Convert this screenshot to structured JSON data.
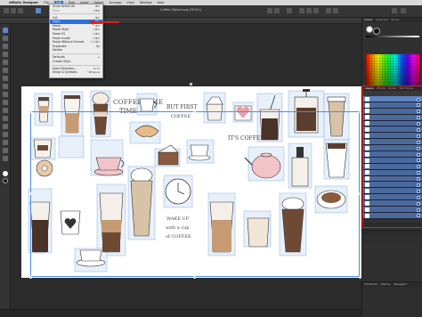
{
  "menubar": {
    "app_name": "Affinity Designer",
    "items": [
      {
        "label": "File"
      },
      {
        "label": "Edit",
        "active": true
      },
      {
        "label": "Text"
      },
      {
        "label": "Layer"
      },
      {
        "label": "Select"
      },
      {
        "label": "Arrange"
      },
      {
        "label": "View"
      },
      {
        "label": "Window"
      },
      {
        "label": "Help"
      }
    ]
  },
  "toolbar": {
    "document_title": "Coffee Object.svg (39.5%)"
  },
  "edit_menu": {
    "items": [
      {
        "label": "Undo Select All",
        "shortcut": "⌘Z",
        "state": "normal"
      },
      {
        "label": "Redo",
        "shortcut": "⇧⌘Z",
        "state": "disabled"
      },
      {
        "sep": true
      },
      {
        "label": "Cut",
        "shortcut": "⌘X",
        "state": "normal"
      },
      {
        "label": "Copy",
        "shortcut": "⌘C",
        "state": "highlighted"
      },
      {
        "label": "Paste",
        "shortcut": "⌘V",
        "state": "normal"
      },
      {
        "label": "Paste Style",
        "shortcut": "⇧⌘V",
        "state": "normal"
      },
      {
        "label": "Paste FX",
        "shortcut": "⌥⌘V",
        "state": "normal"
      },
      {
        "label": "Paste Inside",
        "shortcut": "⌥⌘V",
        "state": "normal"
      },
      {
        "label": "Paste Without Format",
        "shortcut": "⌥⇧⌘V",
        "state": "normal"
      },
      {
        "label": "Duplicate",
        "shortcut": "⌘J",
        "state": "normal"
      },
      {
        "label": "Delete",
        "shortcut": "",
        "state": "normal"
      },
      {
        "sep": true
      },
      {
        "label": "Defaults",
        "shortcut": "▸",
        "state": "normal"
      },
      {
        "label": "Create Style",
        "shortcut": "",
        "state": "normal"
      },
      {
        "sep": true
      },
      {
        "label": "Start Dictation...",
        "shortcut": "fn fn",
        "state": "normal"
      },
      {
        "label": "Emoji & Symbols",
        "shortcut": "^⌘Space",
        "state": "normal"
      }
    ]
  },
  "artwork": {
    "text_coffee_time": "COFFEE\nTIME",
    "text_but_first": "BUT FIRST\nCOFFEE",
    "text_its_coffee": "IT'S COFFEE",
    "text_wake_up": "WAKE UP\nwith a cup\nof COFFEE"
  },
  "panels": {
    "top_tabs": [
      "Colour",
      "Swatches",
      "Stroke"
    ],
    "layers_tabs": [
      "Layers",
      "Effects",
      "Styles",
      "Text Styles"
    ],
    "bottom_tabs": [
      "Transform",
      "History",
      "Navigator"
    ]
  },
  "colors": {
    "highlight": "#2d6fd8",
    "annotation_red": "#e0201a",
    "layer_row": "#4a6a9c"
  }
}
